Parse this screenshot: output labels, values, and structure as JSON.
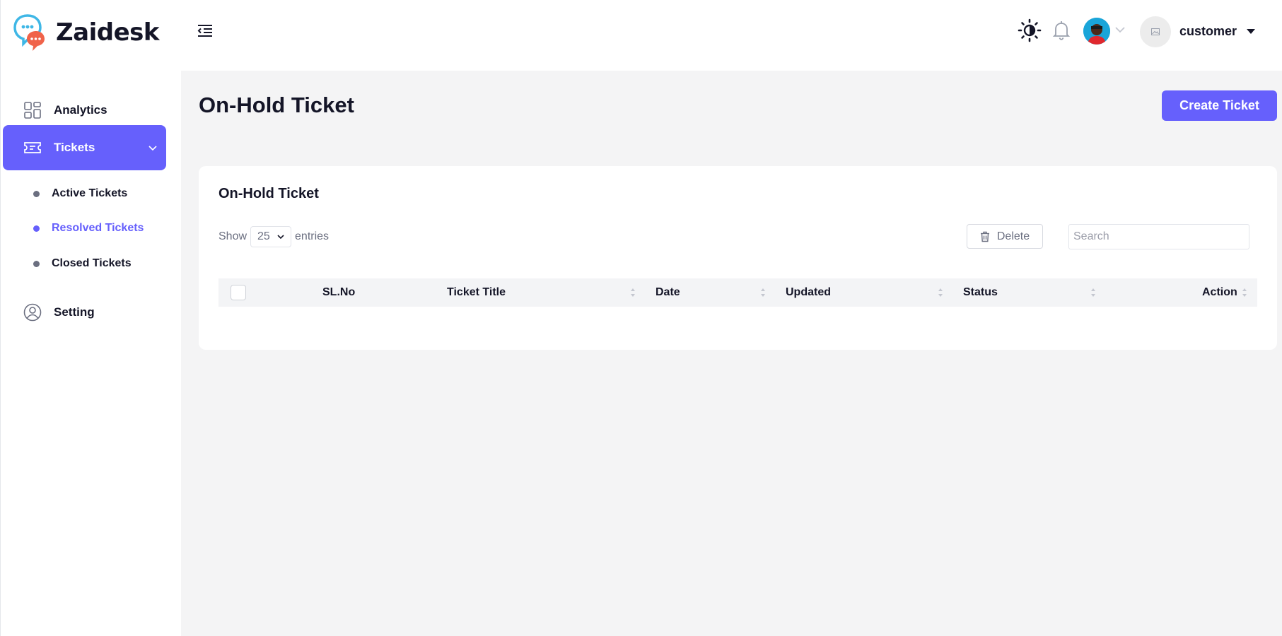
{
  "brand": {
    "name": "Zaidesk"
  },
  "sidebar": {
    "items": [
      {
        "label": "Analytics",
        "icon": "grid-icon"
      },
      {
        "label": "Tickets",
        "icon": "ticket-icon",
        "active": true
      },
      {
        "label": "Setting",
        "icon": "user-circle-icon"
      }
    ],
    "sub_items": [
      {
        "label": "Active Tickets"
      },
      {
        "label": "Resolved Tickets",
        "current": true
      },
      {
        "label": "Closed Tickets"
      }
    ]
  },
  "header": {
    "user_name": "customer",
    "icons": [
      "menu-toggle-icon",
      "theme-toggle-icon",
      "bell-icon",
      "avatar",
      "user-avatar"
    ]
  },
  "main": {
    "title": "On-Hold Ticket",
    "create_button": "Create Ticket",
    "card": {
      "title": "On-Hold Ticket",
      "show_label": "Show",
      "entries_value": "25",
      "entries_label": "entries",
      "delete_label": "Delete",
      "search_placeholder": "Search",
      "columns": [
        "SL.No",
        "Ticket Title",
        "Date",
        "Updated",
        "Status",
        "Action"
      ]
    }
  },
  "colors": {
    "accent": "#6660fc",
    "background": "#f4f4f5",
    "text": "#141527"
  }
}
